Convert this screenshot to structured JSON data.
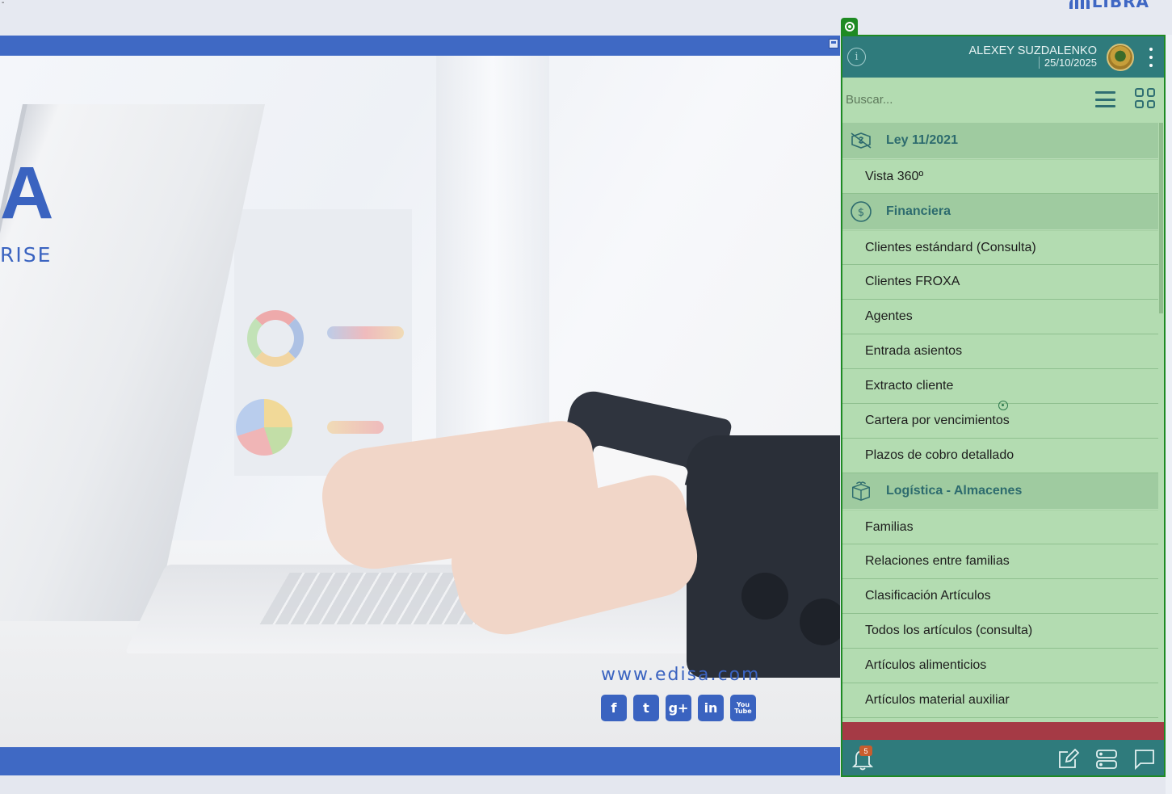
{
  "brand": {
    "logo_text": "LIBRA",
    "accent": "#3f69c4"
  },
  "hero": {
    "letter": "A",
    "tagline_fragment": "RISE",
    "website": "www.edisa.com",
    "socials": [
      "f",
      "t",
      "g+",
      "in",
      "You Tube"
    ]
  },
  "user": {
    "name": "ALEXEY SUZDALENKO",
    "date": "25/10/2025"
  },
  "search": {
    "placeholder": "Buscar..."
  },
  "menu": {
    "sections": [
      {
        "label": "Ley 11/2021",
        "icon": "dollar-off-icon",
        "items": [
          "Vista 360º"
        ]
      },
      {
        "label": "Financiera",
        "icon": "dollar-circle-icon",
        "items": [
          "Clientes estándard (Consulta)",
          "Clientes FROXA",
          "Agentes",
          "Entrada asientos",
          "Extracto cliente",
          "Cartera por vencimientos",
          "Plazos de cobro detallado"
        ]
      },
      {
        "label": "Logística - Almacenes",
        "icon": "box-icon",
        "items": [
          "Familias",
          "Relaciones entre familias",
          "Clasificación Artículos",
          "Todos los artículos (consulta)",
          "Artículos alimenticios",
          "Artículos material auxiliar"
        ]
      }
    ]
  },
  "footer": {
    "notification_count": "5"
  },
  "colors": {
    "panel_bg": "#b3dcb1",
    "panel_header": "#2f7b7c",
    "section_bg": "#9fcba0",
    "section_text": "#2d6b6e",
    "panel_border": "#1e8a23",
    "alert_bar": "#a53a45"
  }
}
